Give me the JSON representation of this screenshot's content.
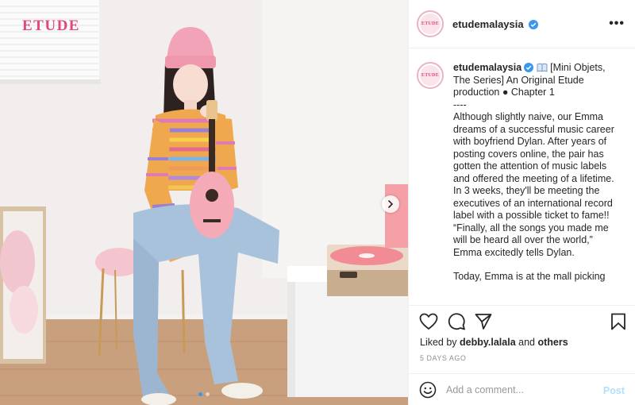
{
  "brand": {
    "logo_text": "ETUDE"
  },
  "colors": {
    "brand_pink": "#e0487b",
    "verified_blue": "#3897f0",
    "post_button": "#b2dffc"
  },
  "header": {
    "username": "etudemalaysia",
    "verified_icon": "verified-badge-icon",
    "more_icon": "more-options-icon"
  },
  "caption": {
    "username": "etudemalaysia",
    "book_icon": "open-book-emoji",
    "paragraph1": "[Mini Objets, The Series] An Original Etude production ● Chapter 1\n----\nAlthough slightly naive, our Emma dreams of a successful music career with boyfriend Dylan. After years of posting covers online, the pair has gotten the attention of music labels and offered the meeting of a lifetime. In 3 weeks, they'll be meeting the executives of an international record label with a possible ticket to fame!! “Finally, all the songs you made me will be heard all over the world,” Emma excitedly tells Dylan.",
    "paragraph2": "Today, Emma is at the mall picking"
  },
  "actions": {
    "like_icon": "heart-icon",
    "comment_icon": "comment-icon",
    "share_icon": "share-icon",
    "save_icon": "bookmark-icon"
  },
  "likes": {
    "prefix": "Liked by ",
    "user": "debby.lalala",
    "middle": " and ",
    "others": "others"
  },
  "timestamp": "5 DAYS AGO",
  "comment_box": {
    "emoji_icon": "emoji-icon",
    "placeholder": "Add a comment...",
    "post_label": "Post"
  },
  "carousel": {
    "total_slides": 2,
    "current_slide": 1,
    "next_icon": "chevron-right-icon"
  }
}
